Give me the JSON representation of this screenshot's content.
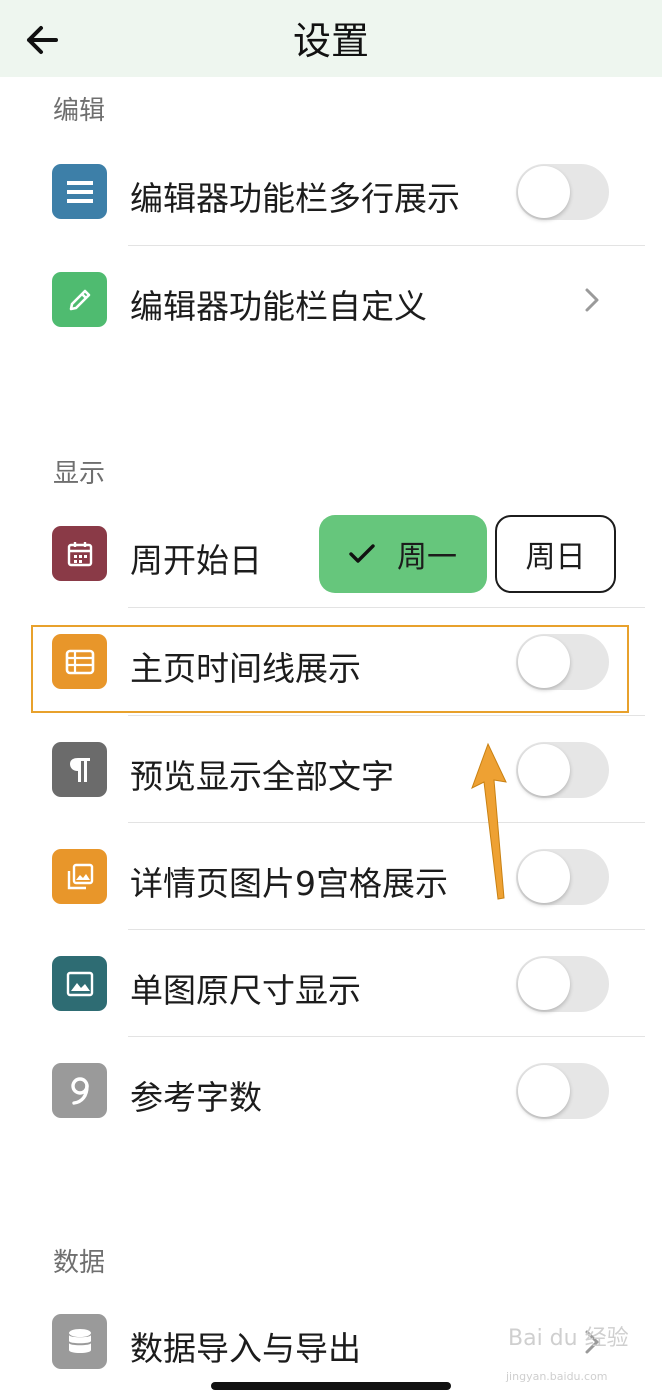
{
  "header": {
    "title": "设置"
  },
  "sections": {
    "editing": "编辑",
    "display": "显示",
    "data": "数据"
  },
  "editing_rows": {
    "multiline_toolbar": {
      "label": "编辑器功能栏多行展示",
      "toggle_on": false
    },
    "custom_toolbar": {
      "label": "编辑器功能栏自定义"
    }
  },
  "display_rows": {
    "week_start": {
      "label": "周开始日",
      "option_selected": "周一",
      "option_other": "周日"
    },
    "home_timeline": {
      "label": "主页时间线展示",
      "toggle_on": false
    },
    "preview_all_text": {
      "label": "预览显示全部文字",
      "toggle_on": false
    },
    "detail_grid": {
      "label": "详情页图片9宫格展示",
      "toggle_on": false
    },
    "single_image_original": {
      "label": "单图原尺寸显示",
      "toggle_on": false
    },
    "reference_word_count": {
      "label": "参考字数",
      "toggle_on": false
    }
  },
  "data_rows": {
    "import_export": {
      "label": "数据导入与导出"
    }
  },
  "colors": {
    "header_bg": "#eef6ef",
    "accent_green": "#66c67c",
    "highlight_orange": "#e8a12c",
    "icon_blue": "#3d7fa8",
    "icon_green": "#4fbb70",
    "icon_maroon": "#8a3a47",
    "icon_orange": "#e8962a",
    "icon_gray": "#6b6b6b",
    "icon_teal": "#2e6c73",
    "icon_light_gray": "#9a9a9a"
  },
  "watermark": {
    "text": "Bai du 经验",
    "url": "jingyan.baidu.com"
  }
}
